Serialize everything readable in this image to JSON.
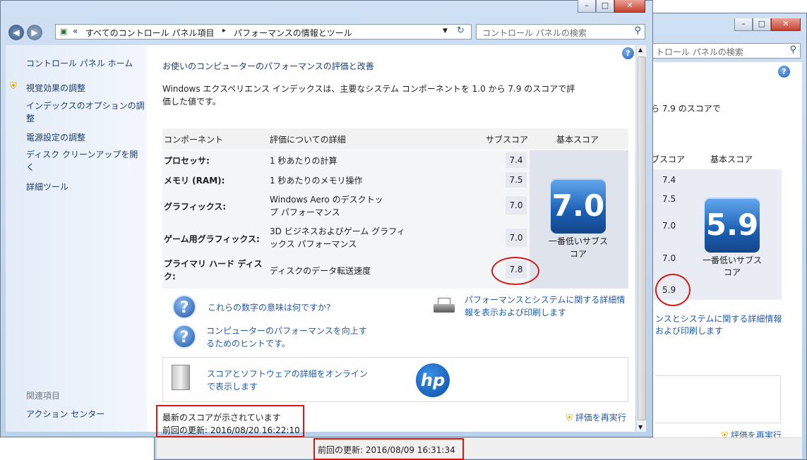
{
  "back_window": {
    "search_placeholder": "トロール パネルの検索",
    "desc_fragment": "ら 7.9 のスコアで",
    "col_subscore": "ブスコア",
    "col_basescore": "基本スコア",
    "subscores": [
      "7.4",
      "7.5",
      "7.0",
      "7.0",
      "5.9"
    ],
    "base_score": "5.9",
    "base_caption": "一番低いサブスコア",
    "link_fragment": "ンスとシステムに関する詳細情報および印刷します",
    "rerun_label": "評価を再実行",
    "last_update": "前回の更新: 2016/08/09 16:31:34"
  },
  "front_window": {
    "breadcrumb_root": "すべてのコントロール パネル項目",
    "breadcrumb_current": "パフォーマンスの情報とツール",
    "search_placeholder": "コントロール パネルの検索",
    "sidebar": {
      "home": "コントロール パネル ホーム",
      "items": [
        "視覚効果の調整",
        "インデックスのオプションの調整",
        "電源設定の調整",
        "ディスク クリーンアップを開く",
        "詳細ツール"
      ],
      "related_heading": "関連項目",
      "related_items": [
        "アクション センター"
      ]
    },
    "heading": "お使いのコンピューターのパフォーマンスの評価と改善",
    "description": "Windows エクスペリエンス インデックスは、主要なシステム コンポーネントを 1.0 から 7.9 のスコアで評価した値です。",
    "table": {
      "headers": [
        "コンポーネント",
        "評価についての詳細",
        "サブスコア",
        "基本スコア"
      ],
      "rows": [
        {
          "component": "プロセッサ:",
          "detail": "1 秒あたりの計算",
          "subscore": "7.4"
        },
        {
          "component": "メモリ (RAM):",
          "detail": "1 秒あたりのメモリ操作",
          "subscore": "7.5"
        },
        {
          "component": "グラフィックス:",
          "detail": "Windows Aero のデスクトップ パフォーマンス",
          "subscore": "7.0"
        },
        {
          "component": "ゲーム用グラフィックス:",
          "detail": "3D ビジネスおよびゲーム グラフィックス パフォーマンス",
          "subscore": "7.0"
        },
        {
          "component": "プライマリ ハード ディスク:",
          "detail": "ディスクのデータ転送速度",
          "subscore": "7.8"
        }
      ],
      "base_score": "7.0",
      "base_caption": "一番低いサブスコア"
    },
    "links": {
      "what_numbers": "これらの数字の意味は何ですか?",
      "tips": "コンピューターのパフォーマンスを向上するためのヒントです。",
      "print_details": "パフォーマンスとシステムに関する詳細情報を表示および印刷します",
      "online": "スコアとソフトウェアの詳細をオンラインで表示します"
    },
    "logo_text": "hp",
    "status_current": "最新のスコアが示されています",
    "last_update": "前回の更新: 2016/08/20 16:22:10",
    "rerun_label": "評価を再実行"
  },
  "colors": {
    "link": "#1e5aa8",
    "highlight": "#d21a1a",
    "score_badge": "#1b5fb3"
  }
}
